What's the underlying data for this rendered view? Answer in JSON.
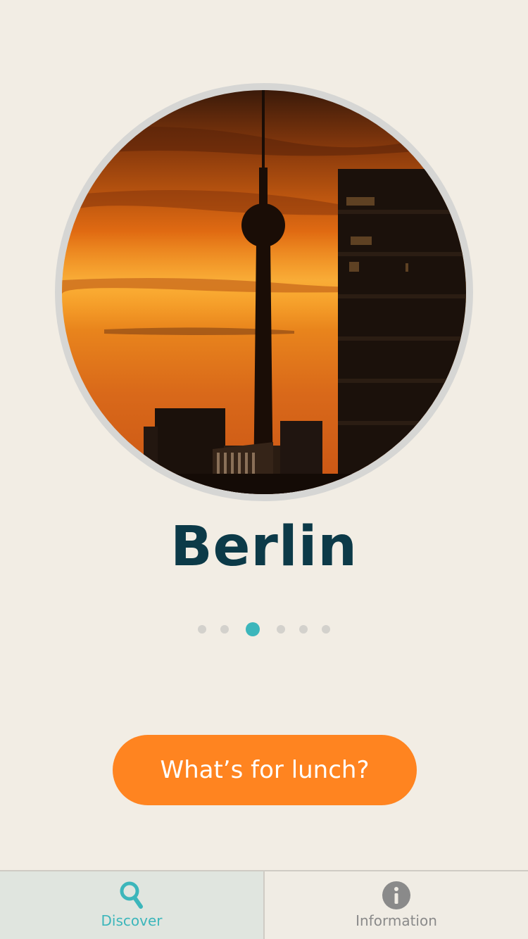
{
  "hero": {
    "image": "berlin-tv-tower-sunset"
  },
  "city": {
    "name": "Berlin"
  },
  "pager": {
    "total": 6,
    "active_index": 2
  },
  "cta": {
    "label": "What’s for lunch?"
  },
  "tabs": [
    {
      "label": "Discover",
      "icon": "search-icon",
      "active": true
    },
    {
      "label": "Information",
      "icon": "info-icon",
      "active": false
    }
  ],
  "colors": {
    "background": "#f2ede4",
    "title": "#0c3a48",
    "accent": "#3cb6bb",
    "cta": "#ff8420",
    "inactive": "#8a8a8a"
  }
}
